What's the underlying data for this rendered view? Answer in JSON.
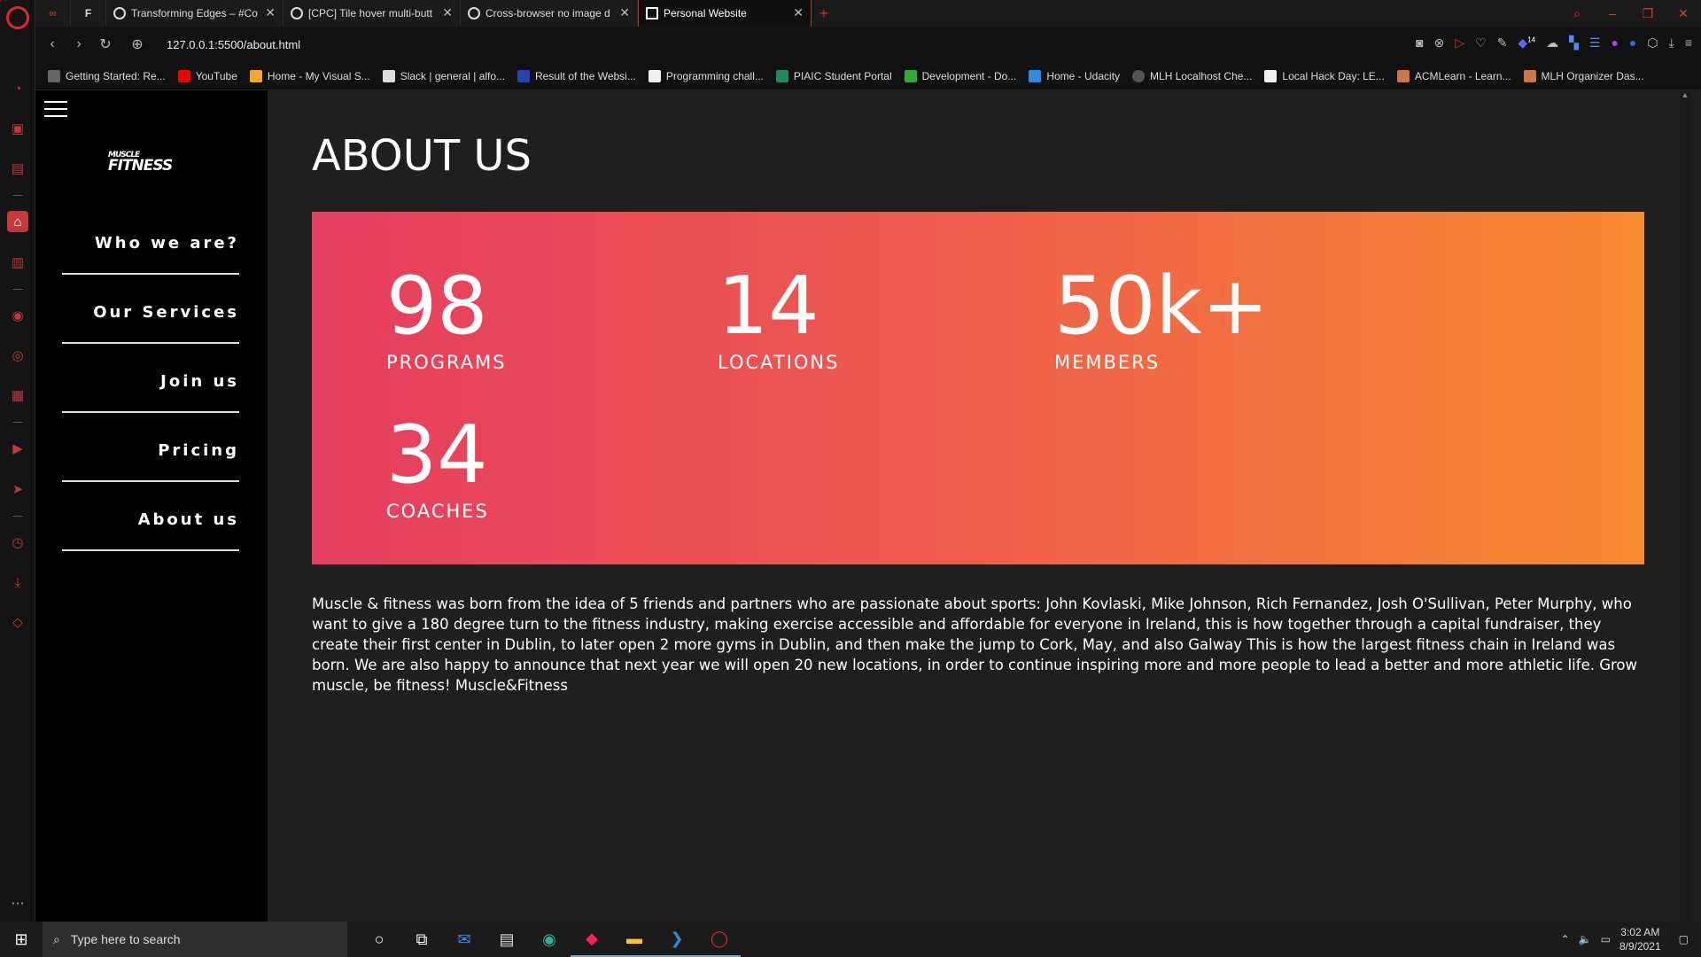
{
  "browser": {
    "tabs": [
      {
        "label": "Transforming Edges – #Co"
      },
      {
        "label": "[CPC] Tile hover multi-butt"
      },
      {
        "label": "Cross-browser no image d"
      },
      {
        "label": "Personal Website"
      }
    ],
    "url": "127.0.0.1:5500/about.html",
    "bookmarks": [
      "Getting Started: Re...",
      "YouTube",
      "Home - My Visual S...",
      "Slack | general | alfo...",
      "Result of the Websi...",
      "Programming chall...",
      "PIAIC Student Portal",
      "Development - Do...",
      "Home - Udacity",
      "MLH Localhost Che...",
      "Local Hack Day: LE...",
      "ACMLearn - Learn...",
      "MLH Organizer Das..."
    ],
    "extension_badge": "14"
  },
  "site": {
    "logo_top": "MUSCLE",
    "logo_bottom": "FITNESS",
    "menu": [
      {
        "label": "Who we are?"
      },
      {
        "label": "Our Services"
      },
      {
        "label": "Join us"
      },
      {
        "label": "Pricing"
      },
      {
        "label": "About us"
      }
    ],
    "page_title": "ABOUT US",
    "stats": [
      {
        "number": "98",
        "label": "PROGRAMS"
      },
      {
        "number": "14",
        "label": "LOCATIONS"
      },
      {
        "number": "50k+",
        "label": "MEMBERS"
      },
      {
        "number": "34",
        "label": "COACHES"
      }
    ],
    "about_text": "Muscle & fitness was born from the idea of 5 friends and partners who are passionate about sports: John Kovlaski, Mike Johnson, Rich Fernandez, Josh O'Sullivan, Peter Murphy, who want to give a 180 degree turn to the fitness industry, making exercise accessible and affordable for everyone in Ireland, this is how together through a capital fundraiser, they create their first center in Dublin, to later open 2 more gyms in Dublin, and then make the jump to Cork, May, and also Galway This is how the largest fitness chain in Ireland was born. We are also happy to announce that next year we will open 20 new locations, in order to continue inspiring more and more people to lead a better and more athletic life. Grow muscle, be fitness! Muscle&Fitness",
    "gradient": [
      "#e53d5f",
      "#f78a30"
    ]
  },
  "taskbar": {
    "search_placeholder": "Type here to search",
    "time": "3:02 AM",
    "date": "8/9/2021"
  }
}
